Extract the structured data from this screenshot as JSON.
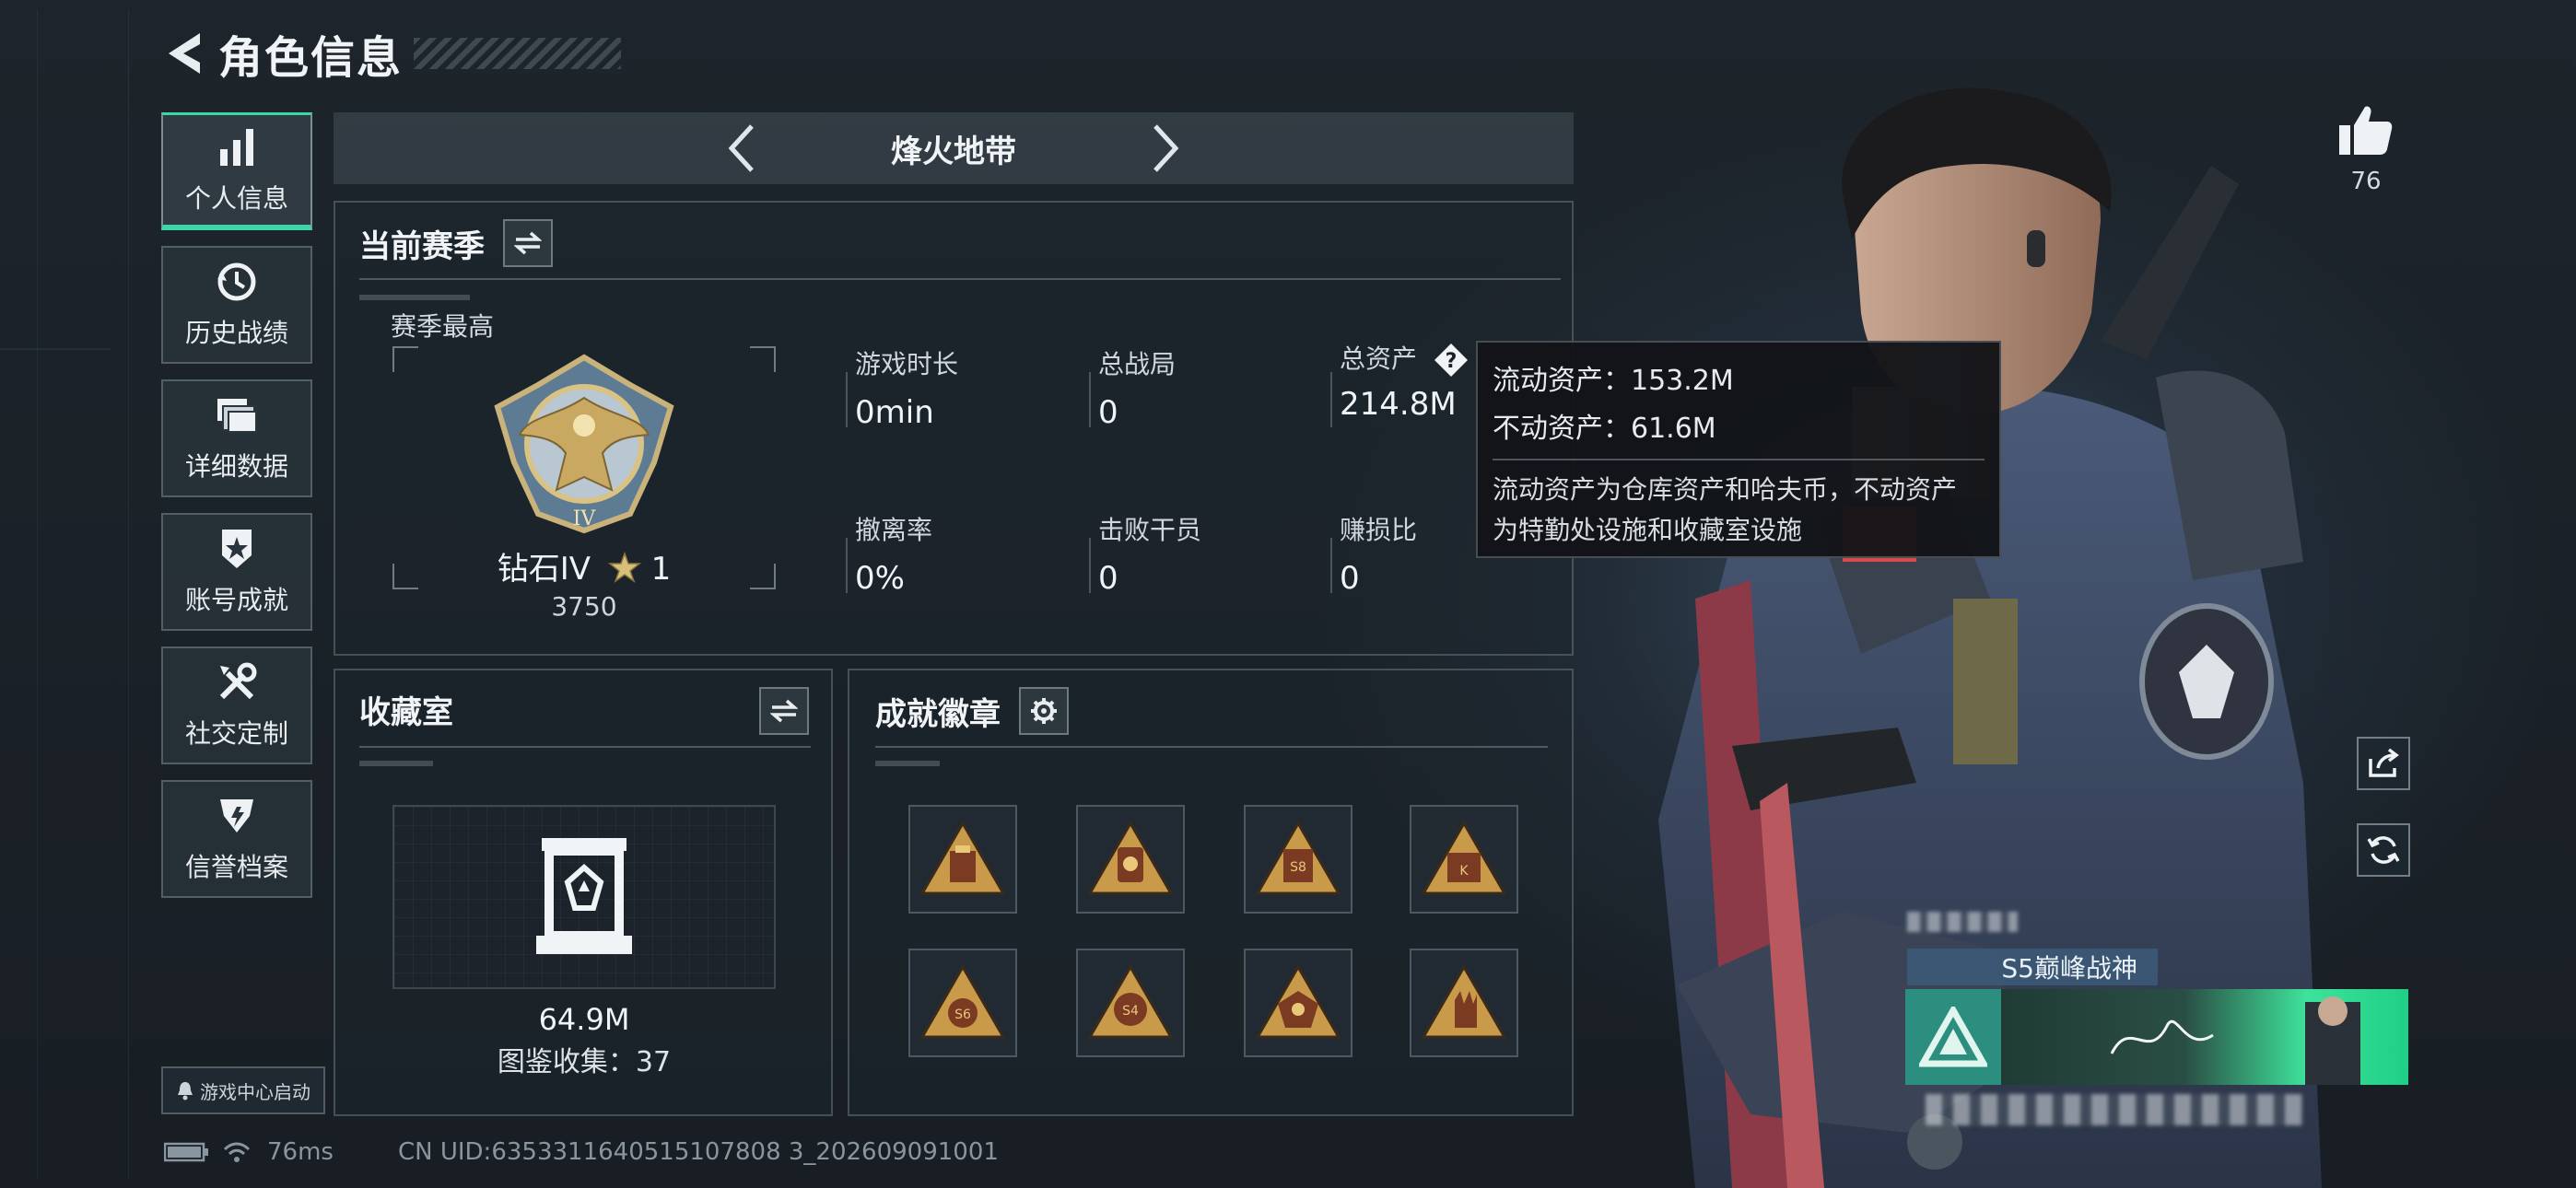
{
  "header": {
    "title": "角色信息"
  },
  "sidebar": {
    "items": [
      {
        "label": "个人信息",
        "icon": "bar-chart-icon"
      },
      {
        "label": "历史战绩",
        "icon": "history-clock-icon"
      },
      {
        "label": "详细数据",
        "icon": "folder-stack-icon"
      },
      {
        "label": "账号成就",
        "icon": "achievement-star-icon"
      },
      {
        "label": "社交定制",
        "icon": "tools-icon"
      },
      {
        "label": "信誉档案",
        "icon": "shield-emblem-icon"
      }
    ],
    "active_index": 0
  },
  "game_center": {
    "label": "游戏中心启动"
  },
  "mode": {
    "title": "烽火地带"
  },
  "season": {
    "title": "当前赛季",
    "subtitle": "赛季最高",
    "rank_name": "钻石IV",
    "rank_stars": "1",
    "rank_score": "3750",
    "stats": [
      {
        "label": "游戏时长",
        "value": "0min"
      },
      {
        "label": "总战局",
        "value": "0"
      },
      {
        "label": "总资产",
        "value": "214.8M"
      },
      {
        "label": "撤离率",
        "value": "0%"
      },
      {
        "label": "击败干员",
        "value": "0"
      },
      {
        "label": "赚损比",
        "value": "0"
      }
    ]
  },
  "tooltip": {
    "liquid": "流动资产：153.2M",
    "fixed": "不动资产：61.6M",
    "desc_line1": "流动资产为仓库资产和哈夫币，不动资产",
    "desc_line2": "为特勤处设施和收藏室设施"
  },
  "collection": {
    "title": "收藏室",
    "value": "64.9M",
    "count": "图鉴收集：37"
  },
  "badges": {
    "title": "成就徽章",
    "items": [
      "badge-1",
      "badge-2",
      "badge-3",
      "badge-4",
      "badge-5",
      "badge-6",
      "badge-7",
      "badge-8"
    ]
  },
  "likes": {
    "count": "76"
  },
  "name_card": {
    "title": "S5巅峰战神"
  },
  "status": {
    "ping": "76ms",
    "uid": "CN UID:6353311640515107808 3_202609091001"
  },
  "colors": {
    "accent": "#3cd6a8",
    "background": "#1a2026"
  }
}
